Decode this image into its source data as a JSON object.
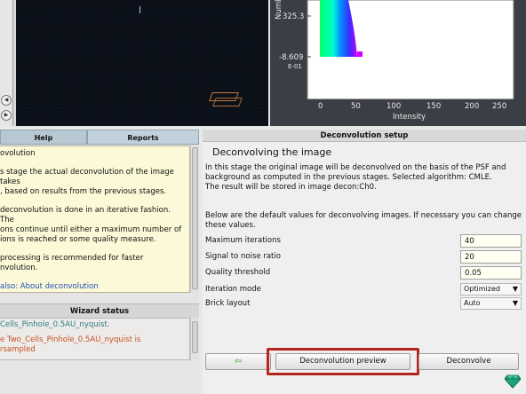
{
  "viewport": {
    "buttons": [
      "◀",
      "▶"
    ]
  },
  "histogram": {
    "y_top_tick": "325.3",
    "y_bottom_tick": "-8.609",
    "y_bottom_exp": "E-01",
    "y_label_fragment": "Numb",
    "x_ticks": [
      "0",
      "50",
      "100",
      "150",
      "200",
      "250"
    ],
    "x_label": "Intensity"
  },
  "left_panel": {
    "tabs": [
      "Help",
      "Reports"
    ],
    "help_title": "ovolution",
    "help_p1": "s stage the actual deconvolution of the image takes\n, based on results from the previous stages.",
    "help_p2": "deconvolution is done in an iterative fashion. The\nons continue until either a maximum number of\nions is reached or some quality measure.",
    "help_p3": "processing is recommended for faster\nnvolution.",
    "help_link": "also: About deconvolution",
    "wizard_title": "Wizard status",
    "wizard_ok": "Cells_Pinhole_0.5AU_nyquist.",
    "wizard_warn": "e Two_Cells_Pinhole_0.5AU_nyquist is\nrsampled"
  },
  "setup": {
    "header": "Deconvolution setup",
    "title": "Deconvolving the image",
    "description": "In this stage the original image will be deconvolved on the basis of the PSF and background as computed in the previous stages. Selected algorithm: CMLE.\nThe result will be stored in image decon:Ch0.",
    "defaults_note": "Below are the default values for deconvolving images. If necessary you can change these values.",
    "params": [
      {
        "label": "Maximum iterations",
        "value": "40"
      },
      {
        "label": "Signal to noise ratio",
        "value": "20"
      },
      {
        "label": "Quality threshold",
        "value": "0.05"
      }
    ],
    "selects": [
      {
        "label": "Iteration mode",
        "value": "Optimized"
      },
      {
        "label": "Brick layout",
        "value": "Auto"
      }
    ],
    "buttons": {
      "back": "⇦",
      "preview": "Deconvolution preview",
      "deconvolve": "Deconvolve"
    }
  },
  "icons": {
    "back_arrow": "left-arrow-icon",
    "gem": "gem-icon"
  }
}
